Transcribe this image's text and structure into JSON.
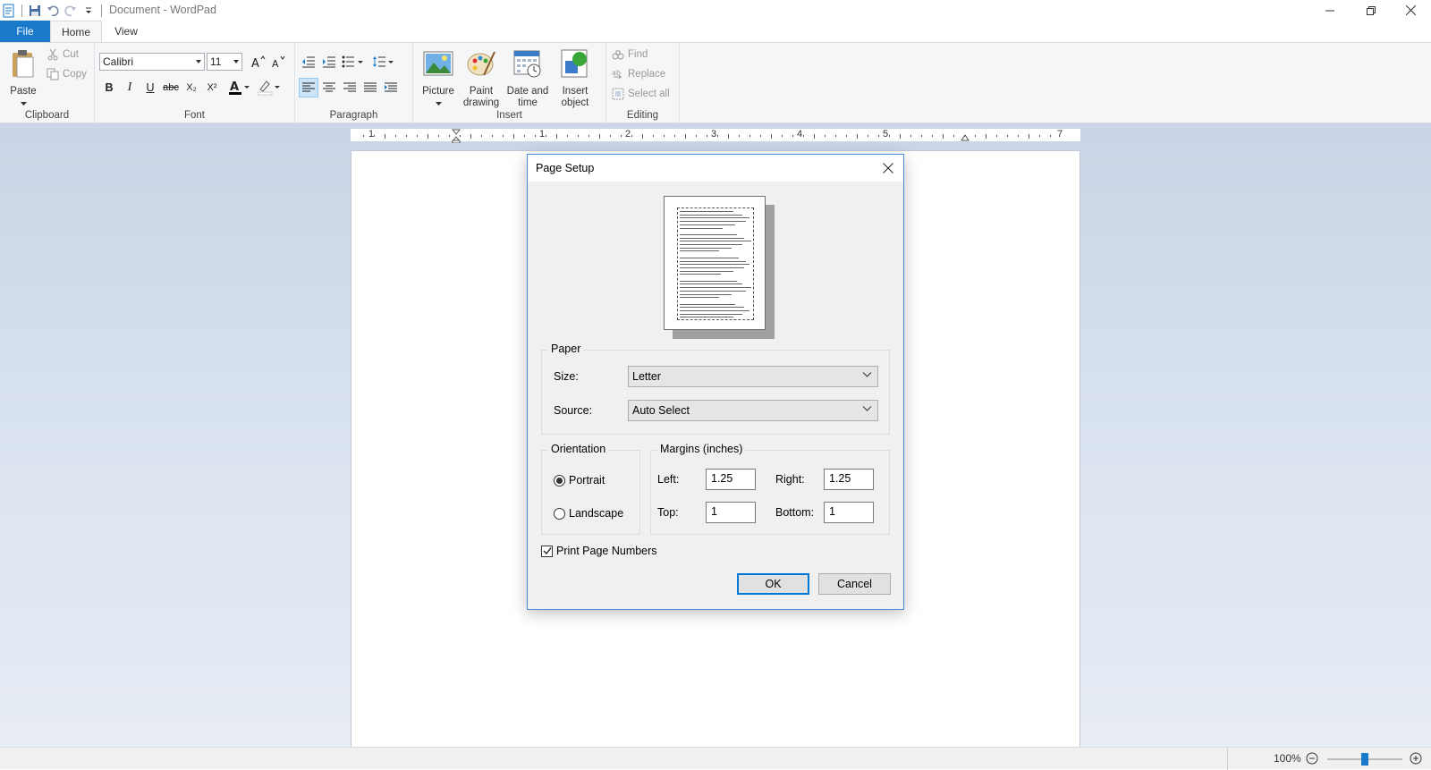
{
  "window": {
    "title": "Document - WordPad"
  },
  "ribbon": {
    "tabs": [
      {
        "label": "File"
      },
      {
        "label": "Home"
      },
      {
        "label": "View"
      }
    ],
    "clipboard": {
      "group_label": "Clipboard",
      "paste": "Paste",
      "cut": "Cut",
      "copy": "Copy"
    },
    "font": {
      "group_label": "Font",
      "family": "Calibri",
      "size": "11",
      "bold": "B",
      "italic": "I",
      "underline": "U",
      "strikethrough": "abc",
      "subscript": "X₂",
      "superscript": "X²"
    },
    "paragraph": {
      "group_label": "Paragraph"
    },
    "insert": {
      "group_label": "Insert",
      "picture": "Picture",
      "paint_drawing_1": "Paint",
      "paint_drawing_2": "drawing",
      "date_time_1": "Date and",
      "date_time_2": "time",
      "insert_object_1": "Insert",
      "insert_object_2": "object"
    },
    "editing": {
      "group_label": "Editing",
      "find": "Find",
      "replace": "Replace",
      "select_all": "Select all"
    }
  },
  "ruler": {
    "numbers": [
      "1",
      "1",
      "2",
      "3",
      "4",
      "5",
      "7"
    ]
  },
  "status": {
    "zoom": "100%",
    "zoom_level": 0.5
  },
  "dialog": {
    "title": "Page Setup",
    "paper": {
      "legend": "Paper",
      "size_label": "Size:",
      "size_value": "Letter",
      "source_label": "Source:",
      "source_value": "Auto Select"
    },
    "orientation": {
      "legend": "Orientation",
      "portrait": "Portrait",
      "landscape": "Landscape",
      "selected": "Portrait"
    },
    "margins": {
      "legend": "Margins (inches)",
      "left_label": "Left:",
      "left_value": "1.25",
      "right_label": "Right:",
      "right_value": "1.25",
      "top_label": "Top:",
      "top_value": "1",
      "bottom_label": "Bottom:",
      "bottom_value": "1"
    },
    "print_page_numbers": {
      "label": "Print Page Numbers",
      "checked": true
    },
    "ok": "OK",
    "cancel": "Cancel"
  },
  "colors": {
    "accent": "#1979ca",
    "ribbon_bg": "#f5f6f7",
    "workspace": "#c9d4e6"
  }
}
